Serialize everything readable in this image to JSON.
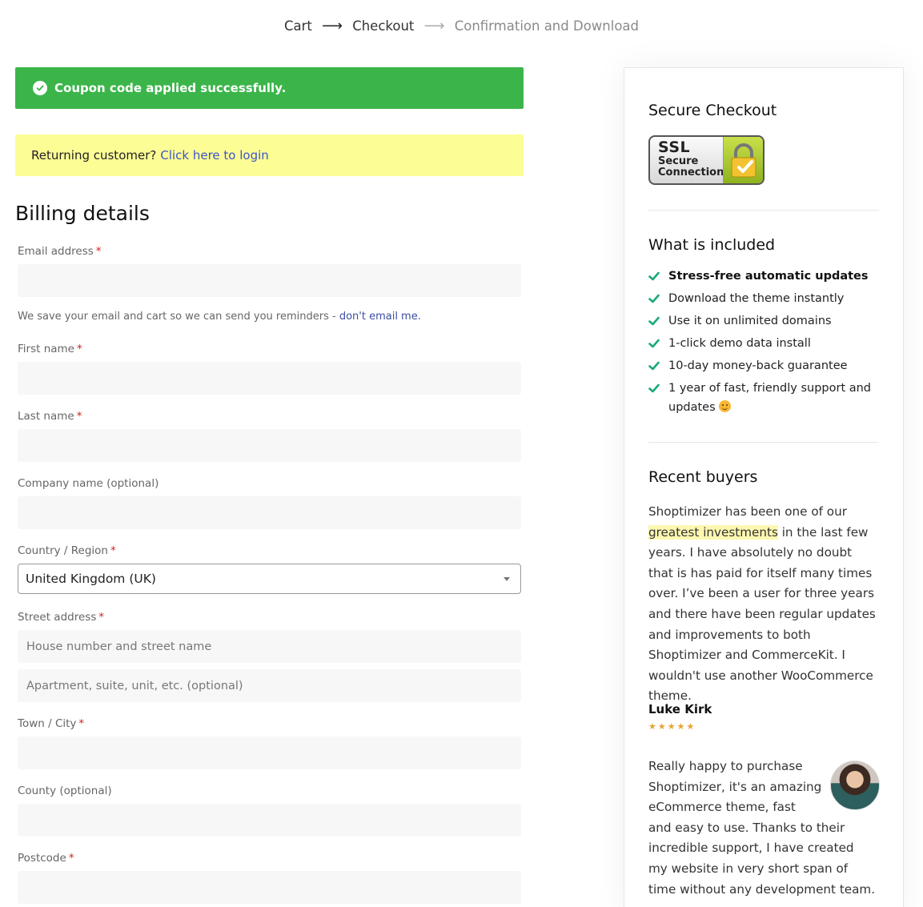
{
  "breadcrumb": {
    "step1": "Cart",
    "arrow1": "⟶",
    "step2": "Checkout",
    "arrow2": "⟶",
    "step3": "Confirmation and Download"
  },
  "notices": {
    "success": "Coupon code applied successfully.",
    "login_prompt": "Returning customer?",
    "login_link": "Click here to login"
  },
  "billing": {
    "title": "Billing details",
    "required_mark": "*",
    "email_label": "Email address",
    "email_value": "",
    "email_hint": "We save your email and cart so we can send you reminders - ",
    "email_hint_link": "don't email me.",
    "first_name_label": "First name",
    "last_name_label": "Last name",
    "company_label": "Company name (optional)",
    "country_label": "Country / Region",
    "country_value": "United Kingdom (UK)",
    "street_label": "Street address",
    "street_placeholder": "House number and street name",
    "apartment_placeholder": "Apartment, suite, unit, etc. (optional)",
    "city_label": "Town / City",
    "county_label": "County (optional)",
    "postcode_label": "Postcode"
  },
  "sidebar": {
    "secure_title": "Secure Checkout",
    "ssl_line1": "SSL",
    "ssl_line2": "Secure",
    "ssl_line3": "Connection",
    "included_title": "What is included",
    "included": [
      "Stress-free automatic updates",
      "Download the theme instantly",
      "Use it on unlimited domains",
      "1-click demo data install",
      "10-day money-back guarantee",
      "1 year of fast, friendly support and updates"
    ],
    "buyers_title": "Recent buyers",
    "review1_before": "Shoptimizer has been one of our",
    "review1_highlight": "greatest investments",
    "review1_after": "in the last few years. I have absolutely no doubt that is has paid for itself many times over. I’ve been a user for three years and there have been regular updates and improvements to both Shoptimizer and CommerceKit. I wouldn't use another WooCommerce theme.",
    "review1_author": "Luke Kirk",
    "review1_stars": "★★★★★",
    "review2_text": "Really happy to purchase Shoptimizer, it's an amazing eCommerce theme, fast and easy to use. Thanks to their incredible support, I have created my website in very short span of time without any development team."
  },
  "colors": {
    "success_green": "#3bb54a",
    "notice_yellow": "#fdfd96",
    "link_blue": "#3c55c3",
    "check_green": "#19a87e",
    "star_gold": "#e7a332"
  }
}
